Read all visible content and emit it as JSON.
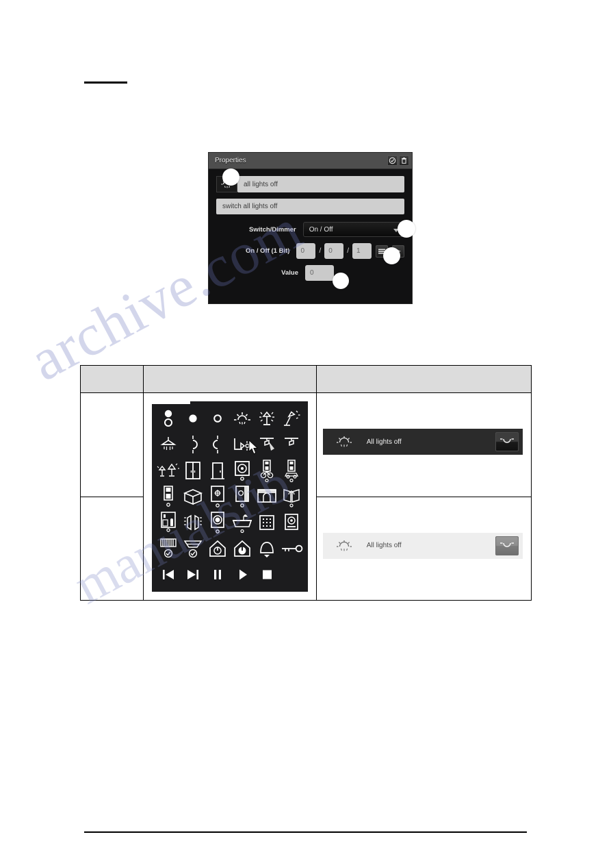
{
  "page": {
    "heading_rule": true,
    "footer_rule": true,
    "watermark_text_1": "archive.com",
    "watermark_text_2": "manualslib"
  },
  "properties_panel": {
    "title": "Properties",
    "header_buttons": [
      {
        "name": "confirm-icon",
        "label": "OK"
      },
      {
        "name": "delete-icon",
        "label": "Delete"
      }
    ],
    "name_field": {
      "value": "all lights off",
      "placeholder": "all lights off"
    },
    "description_field": {
      "value": "switch all lights off",
      "placeholder": "switch all lights off"
    },
    "icon_button_name": "light-off-icon",
    "rows": [
      {
        "label": "Switch/Dimmer",
        "type": "select",
        "value": "On / Off"
      },
      {
        "label": "On / Off (1 Bit)",
        "type": "address",
        "values": [
          "0",
          "0",
          "1"
        ]
      },
      {
        "label": "Value",
        "type": "text",
        "value": "0"
      }
    ],
    "callouts": 4
  },
  "table": {
    "columns": [
      "",
      "",
      ""
    ],
    "header_labels": [
      "",
      "",
      ""
    ],
    "icon_palette": {
      "rows": [
        [
          "circle-pair",
          "circle-filled",
          "circle-outline",
          "ceiling-light",
          "table-lamp",
          "desk-lamp"
        ],
        [
          "pendant-light",
          "wall-light-right",
          "wall-light-left",
          "wall-sconce-light",
          "spotlight-left",
          "spotlight-right"
        ],
        [
          "two-lamps",
          "double-door",
          "single-door",
          "socket-outlet",
          "bicycle-garage",
          "car-garage"
        ],
        [
          "battery-charger",
          "folding-door",
          "window-blind",
          "window-half-blind",
          "garage-door",
          "book-light"
        ],
        [
          "kitchen-scene",
          "shutter",
          "washing-machine",
          "bathtub",
          "grid-panel",
          "safe-door"
        ],
        [
          "radiator",
          "ceiling-fan",
          "house-power-on",
          "house-power-off",
          "bell",
          "key"
        ],
        [
          "media-previous",
          "media-next",
          "media-pause",
          "media-play",
          "media-stop"
        ]
      ]
    },
    "widgets": [
      {
        "theme": "dark",
        "label": "All lights off",
        "icon": "light-off-icon",
        "button_icon": "lamp-icon"
      },
      {
        "theme": "light",
        "label": "All lights off",
        "icon": "light-off-icon",
        "button_icon": "lamp-icon"
      }
    ]
  }
}
